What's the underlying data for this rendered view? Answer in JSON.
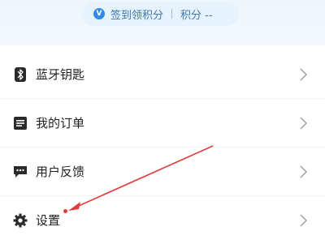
{
  "header": {
    "checkin_label": "签到领积分",
    "points_label": "积分 --",
    "checkin_icon": "V"
  },
  "menu": {
    "items": [
      {
        "label": "蓝牙钥匙",
        "icon": "bluetooth-icon"
      },
      {
        "label": "我的订单",
        "icon": "order-list-icon"
      },
      {
        "label": "用户反馈",
        "icon": "feedback-chat-icon"
      },
      {
        "label": "设置",
        "icon": "gear-icon",
        "badge": true
      }
    ]
  },
  "annotation": {
    "color": "#e23b3b"
  }
}
